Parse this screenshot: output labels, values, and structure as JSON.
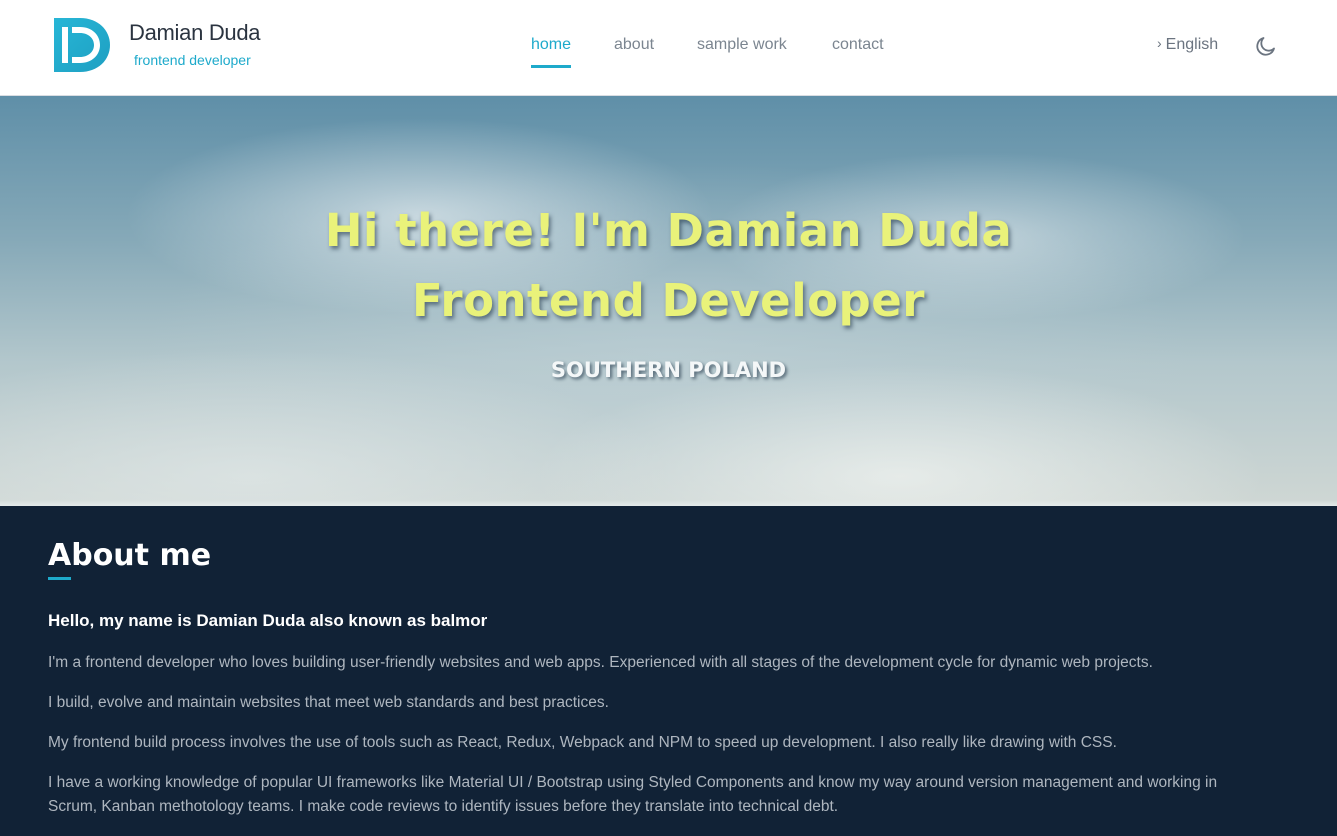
{
  "header": {
    "brand_name": "Damian Duda",
    "brand_subtitle": "frontend developer",
    "logo_icon": "d-letter-logo",
    "accent_color": "#1eaacb",
    "nav": [
      {
        "label": "home",
        "active": true
      },
      {
        "label": "about",
        "active": false
      },
      {
        "label": "sample work",
        "active": false
      },
      {
        "label": "contact",
        "active": false
      }
    ],
    "language": {
      "icon": "chevron-right-icon",
      "label": "English"
    },
    "theme_toggle_icon": "moon-icon"
  },
  "hero": {
    "line1": "Hi there! I'm Damian Duda",
    "line2": "Frontend Developer",
    "location": "SOUTHERN POLAND",
    "headline_color": "#e9f27a"
  },
  "about": {
    "title": "About me",
    "greeting": "Hello, my name is Damian Duda also known as balmor",
    "paragraphs": [
      "I'm a frontend developer who loves building user-friendly websites and web apps. Experienced with all stages of the development cycle for dynamic web projects.",
      "I build, evolve and maintain websites that meet web standards and best practices.",
      "My frontend build process involves the use of tools such as React, Redux, Webpack and NPM to speed up development. I also really like drawing with CSS.",
      "I have a working knowledge of popular UI frameworks like Material UI / Bootstrap using Styled Components and know my way around version management and working in Scrum, Kanban methotology teams. I make code reviews to identify issues before they translate into technical debt."
    ],
    "background_color": "#112236"
  }
}
